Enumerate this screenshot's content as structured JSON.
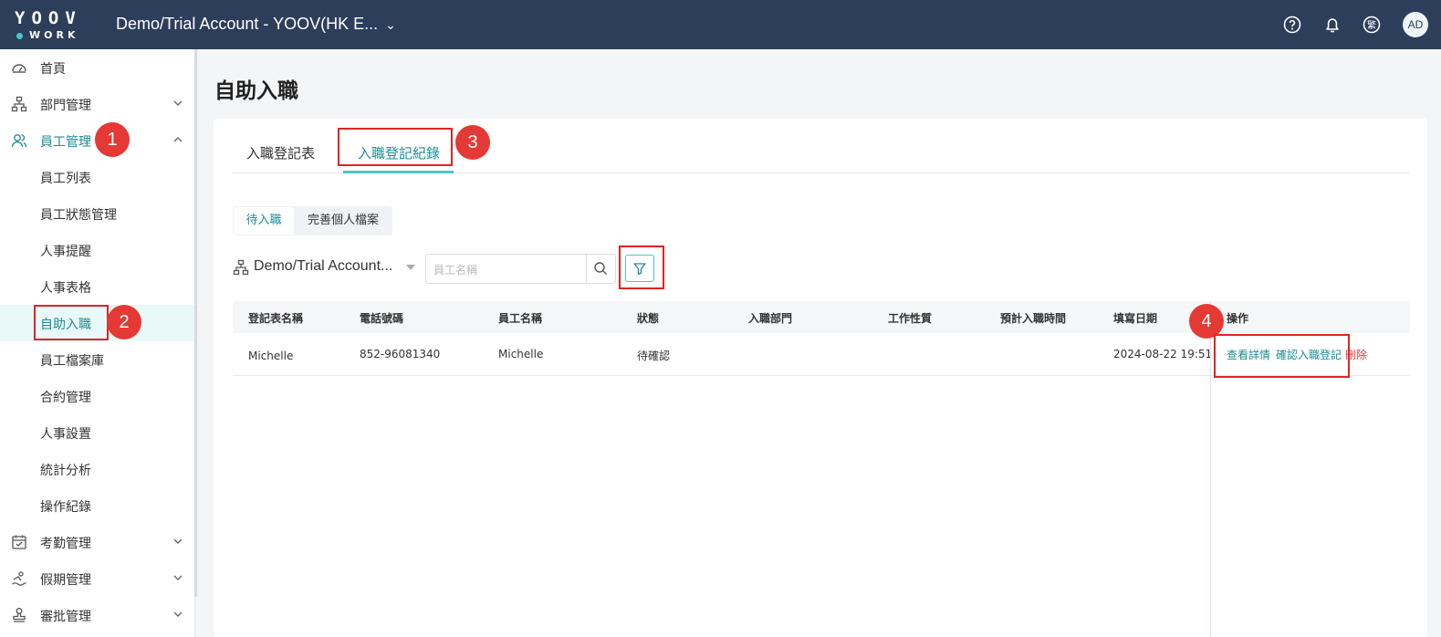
{
  "topbar": {
    "logo_top": "YOOV",
    "logo_bottom": "WORK",
    "account": "Demo/Trial Account - YOOV(HK E...",
    "avatar": "AD",
    "lang_label": "繁"
  },
  "sidebar": {
    "items": [
      {
        "label": "首頁"
      },
      {
        "label": "部門管理"
      },
      {
        "label": "員工管理"
      },
      {
        "label": "員工列表"
      },
      {
        "label": "員工狀態管理"
      },
      {
        "label": "人事提醒"
      },
      {
        "label": "人事表格"
      },
      {
        "label": "自助入職"
      },
      {
        "label": "員工檔案庫"
      },
      {
        "label": "合約管理"
      },
      {
        "label": "人事設置"
      },
      {
        "label": "統計分析"
      },
      {
        "label": "操作紀錄"
      },
      {
        "label": "考勤管理"
      },
      {
        "label": "假期管理"
      },
      {
        "label": "審批管理"
      }
    ]
  },
  "page": {
    "title": "自助入職",
    "tabs": [
      "入職登記表",
      "入職登記紀錄"
    ],
    "segments": [
      "待入職",
      "完善個人檔案"
    ],
    "org": "Demo/Trial Account...",
    "search_placeholder": "員工名稱"
  },
  "table": {
    "headers": [
      "登記表名稱",
      "電話號碼",
      "員工名稱",
      "狀態",
      "入職部門",
      "工作性質",
      "預計入職時間",
      "填寫日期",
      "操作"
    ],
    "rows": [
      {
        "form_name": "Michelle",
        "phone": "852-96081340",
        "employee": "Michelle",
        "status": "待確認",
        "department": "",
        "job_type": "",
        "expected_date": "",
        "filled_date": "2024-08-22 19:51",
        "actions": [
          "查看詳情",
          "確認入職登記",
          "刪除"
        ]
      }
    ]
  },
  "annotations": [
    "1",
    "2",
    "3",
    "4"
  ],
  "colors": {
    "topbar": "#2c3e5a",
    "accent": "#1e8c93",
    "annotation": "#e53935"
  }
}
